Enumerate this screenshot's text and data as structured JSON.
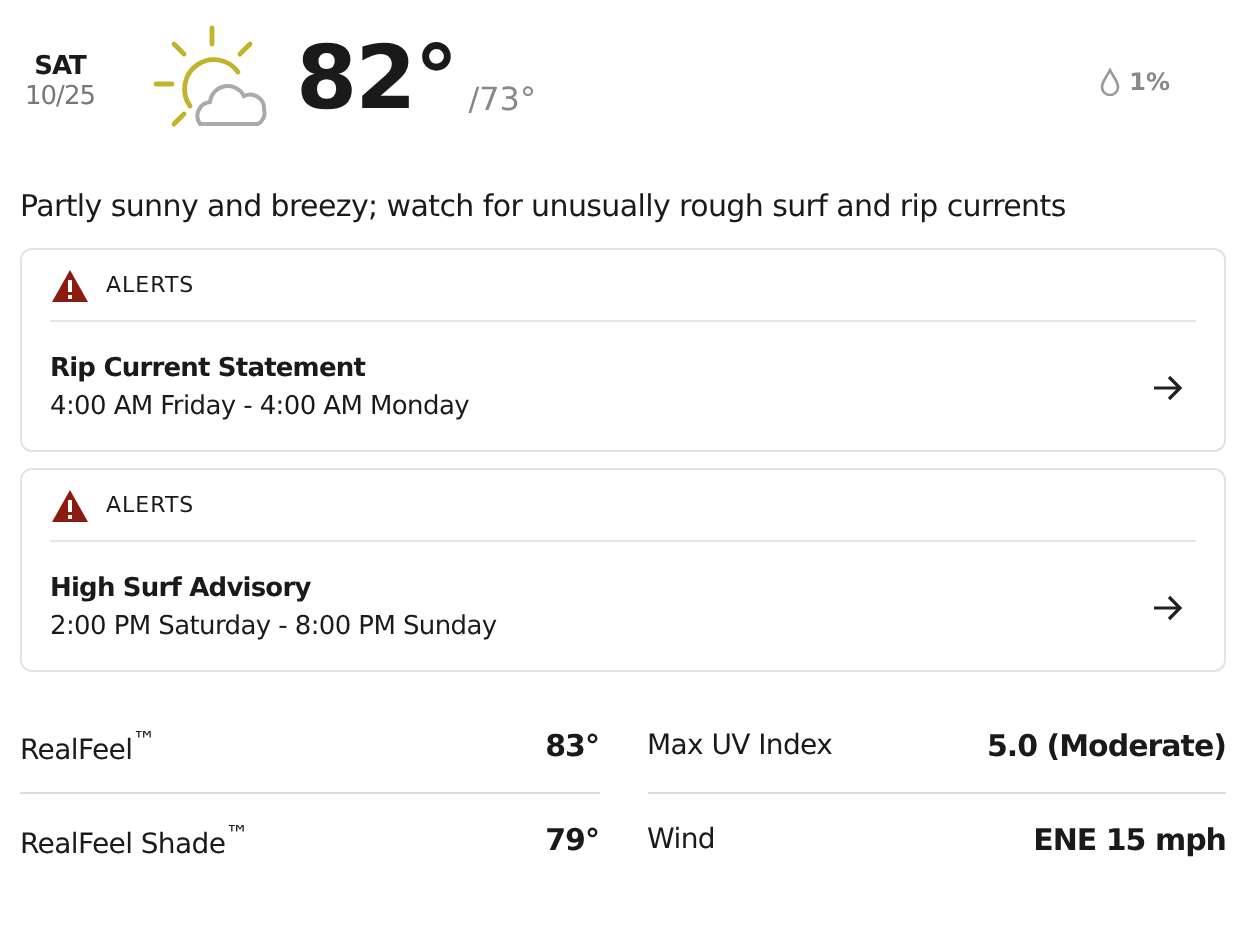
{
  "day": {
    "name": "SAT",
    "date": "10/25"
  },
  "temperature": {
    "high": "82°",
    "low": "/73°"
  },
  "precipitation": "1%",
  "phrase": "Partly sunny and breezy; watch for unusually rough surf and rip currents",
  "alerts": [
    {
      "label": "ALERTS",
      "title": "Rip Current Statement",
      "period": "4:00 AM Friday - 4:00 AM Monday"
    },
    {
      "label": "ALERTS",
      "title": "High Surf Advisory",
      "period": "2:00 PM Saturday - 8:00 PM Sunday"
    }
  ],
  "details": [
    [
      {
        "label": "RealFeel$^{™}$",
        "value": "83°"
      },
      {
        "label": "RealFeel Shade$^{™}$",
        "value": "79°"
      }
    ],
    [
      {
        "label": "Max UV Index",
        "value": "5.0 (Moderate)"
      },
      {
        "label": "Wind",
        "value": "ENE 15 mph"
      }
    ]
  ]
}
